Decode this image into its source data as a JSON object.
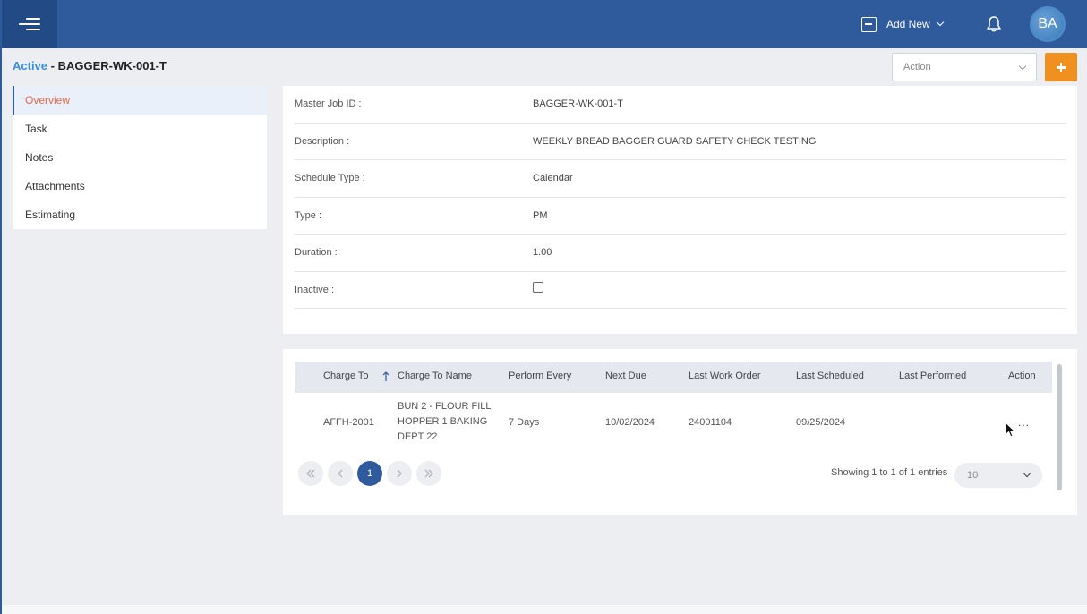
{
  "header": {
    "add_new_label": "Add New",
    "avatar_initials": "BA",
    "brand_color": "#2f5a9b"
  },
  "page": {
    "status": "Active",
    "separator": " - ",
    "job_id": "BAGGER-WK-001-T",
    "action_placeholder": "Action"
  },
  "sidebar": {
    "items": [
      {
        "label": "Overview",
        "active": true
      },
      {
        "label": "Task"
      },
      {
        "label": "Notes"
      },
      {
        "label": "Attachments"
      },
      {
        "label": "Estimating"
      }
    ]
  },
  "details": {
    "master_job_id": {
      "label": "Master Job ID :",
      "value": "BAGGER-WK-001-T"
    },
    "description": {
      "label": "Description :",
      "value": "WEEKLY BREAD BAGGER GUARD SAFETY CHECK TESTING"
    },
    "schedule_type": {
      "label": "Schedule Type :",
      "value": "Calendar"
    },
    "type": {
      "label": "Type :",
      "value": "PM"
    },
    "duration": {
      "label": "Duration :",
      "value": "1.00"
    },
    "inactive": {
      "label": "Inactive :",
      "checked": false
    }
  },
  "table": {
    "columns": [
      "Charge To",
      "Charge To Name",
      "Perform Every",
      "Next Due",
      "Last Work Order",
      "Last Scheduled",
      "Last Performed",
      "Action"
    ],
    "rows": [
      {
        "charge_to": "AFFH-2001",
        "charge_to_name_lines": [
          "BUN 2 - FLOUR FILL",
          "HOPPER 1 BAKING",
          "DEPT 22"
        ],
        "perform_every": "7 Days",
        "next_due": "10/02/2024",
        "last_work_order": "24001104",
        "last_scheduled": "09/25/2024",
        "last_performed": "",
        "action": "..."
      }
    ],
    "pagination": {
      "current_page": "1",
      "showing_text": "Showing 1 to 1 of 1 entries",
      "page_size": "10"
    }
  },
  "accent_color": "#f0901e"
}
